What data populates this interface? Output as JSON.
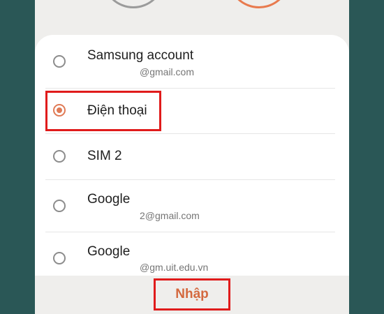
{
  "accounts": [
    {
      "title": "Samsung account",
      "subtitle": "@gmail.com",
      "selected": false
    },
    {
      "title": "Điện thoại",
      "subtitle": "",
      "selected": true
    },
    {
      "title": "SIM 2",
      "subtitle": "",
      "selected": false
    },
    {
      "title": "Google",
      "subtitle": "2@gmail.com",
      "selected": false
    },
    {
      "title": "Google",
      "subtitle": "@gm.uit.edu.vn",
      "selected": false
    }
  ],
  "footer": {
    "enter_label": "Nhập"
  },
  "colors": {
    "accent": "#e07a55",
    "highlight": "#e01b1b",
    "background": "#2a5756"
  }
}
